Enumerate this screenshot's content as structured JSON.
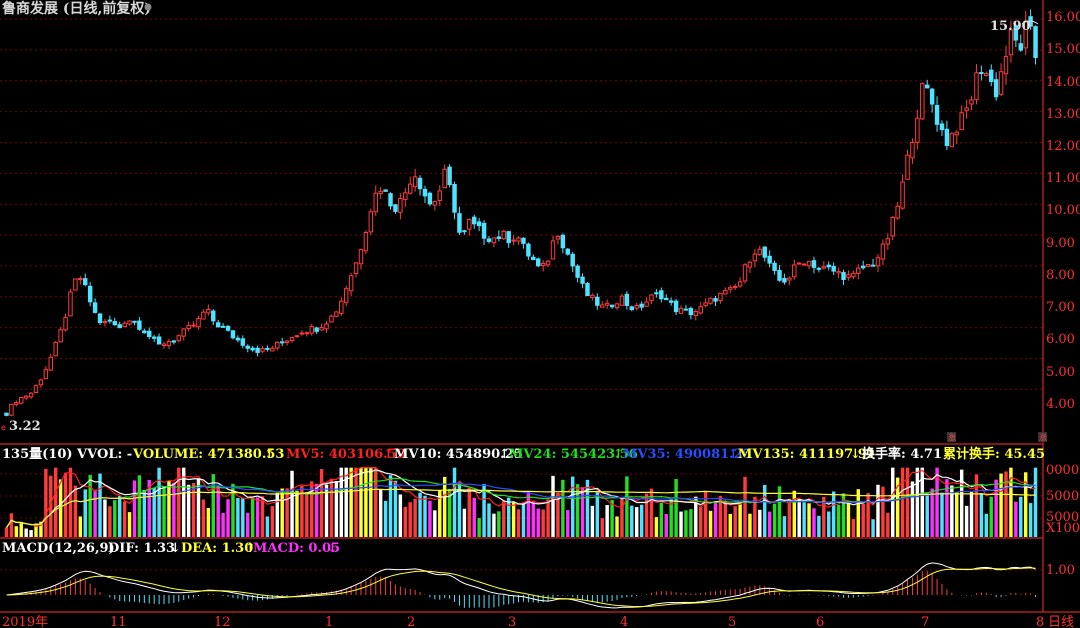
{
  "window": {
    "title": "鲁商发展 (日线,前复权)",
    "period_tab": "日线"
  },
  "colors": {
    "up": "#ff3b3b",
    "down": "#4fe3ff",
    "axis": "#ff3030",
    "grid": "#7a0000",
    "mv5": "#ff2020",
    "mv10": "#ffffff",
    "mv24": "#22dd22",
    "mv35": "#2a4cff",
    "mv135": "#ffff30",
    "dif": "#ffffff",
    "dea": "#ffff30",
    "macd_label": "#ff30ff"
  },
  "price_panel": {
    "high_label": "15.90",
    "low_label": "3.22",
    "y_ticks": [
      "16.00",
      "15.00",
      "14.00",
      "13.00",
      "12.00",
      "11.00",
      "10.00",
      "9.00",
      "8.00",
      "7.00",
      "6.00",
      "5.00",
      "4.00"
    ]
  },
  "volume_panel": {
    "name": "135量(10) VVOL: -",
    "volume": "VOLUME: 471380.53",
    "mv5": "MV5: 403106.59",
    "mv10": "MV10: 454890.25",
    "mv24": "MV24: 545423.56",
    "mv35": "MV35: 490081.25",
    "mv135": "MV135: 411197.91",
    "turnover": "换手率: 4.71",
    "cum_turnover": "累计换手: 45.45",
    "y_ticks": [
      "5000",
      "5000",
      "X100"
    ],
    "y_tick_top": "0000"
  },
  "macd_panel": {
    "name": "MACD(12,26,9)",
    "dif": "DIF: 1.33",
    "dea": "DEA: 1.30",
    "macd": "MACD: 0.05",
    "y_tick": "1.00"
  },
  "time_axis": [
    "2019年",
    "11",
    "12",
    "1",
    "2",
    "3",
    "4",
    "5",
    "6",
    "7",
    "8"
  ],
  "chart_data": {
    "type": "candlestick",
    "symbol": "鲁商发展",
    "period": "日线",
    "adjust": "前复权",
    "ylim": [
      3.2,
      16.1
    ],
    "price_low": 3.22,
    "price_high": 15.9,
    "close_path": [
      3.22,
      3.6,
      3.75,
      3.85,
      4.2,
      4.7,
      5.3,
      6.0,
      7.0,
      7.75,
      7.2,
      6.5,
      6.1,
      6.2,
      5.95,
      6.3,
      6.2,
      6.0,
      5.7,
      5.4,
      5.55,
      5.6,
      5.8,
      6.0,
      6.2,
      6.6,
      6.2,
      6.0,
      5.8,
      5.6,
      5.45,
      5.3,
      5.25,
      5.3,
      5.45,
      5.6,
      5.75,
      5.9,
      5.95,
      6.0,
      6.2,
      6.4,
      6.9,
      7.6,
      8.2,
      9.2,
      10.2,
      10.6,
      10.1,
      9.9,
      10.4,
      11.1,
      10.6,
      10.0,
      10.2,
      11.0,
      10.1,
      8.8,
      9.4,
      9.2,
      9.0,
      8.9,
      9.0,
      8.9,
      9.0,
      8.5,
      8.2,
      7.8,
      8.3,
      9.2,
      8.6,
      8.0,
      7.4,
      7.0,
      6.8,
      6.6,
      6.8,
      7.0,
      6.7,
      6.6,
      6.8,
      7.0,
      7.1,
      6.8,
      6.6,
      6.5,
      6.5,
      6.6,
      6.8,
      7.0,
      7.1,
      7.2,
      7.5,
      8.2,
      8.6,
      8.3,
      7.8,
      7.5,
      7.6,
      8.0,
      8.2,
      8.1,
      7.9,
      7.9,
      7.8,
      7.7,
      7.6,
      7.9,
      8.0,
      8.2,
      8.6,
      9.3,
      10.2,
      11.5,
      12.8,
      13.9,
      13.3,
      12.5,
      12.0,
      12.5,
      12.8,
      13.5,
      14.5,
      14.2,
      13.6,
      14.6,
      15.5,
      15.0,
      15.9,
      14.8
    ],
    "macd_levels": {
      "dif": 1.33,
      "dea": 1.3,
      "macd": 0.05
    }
  }
}
